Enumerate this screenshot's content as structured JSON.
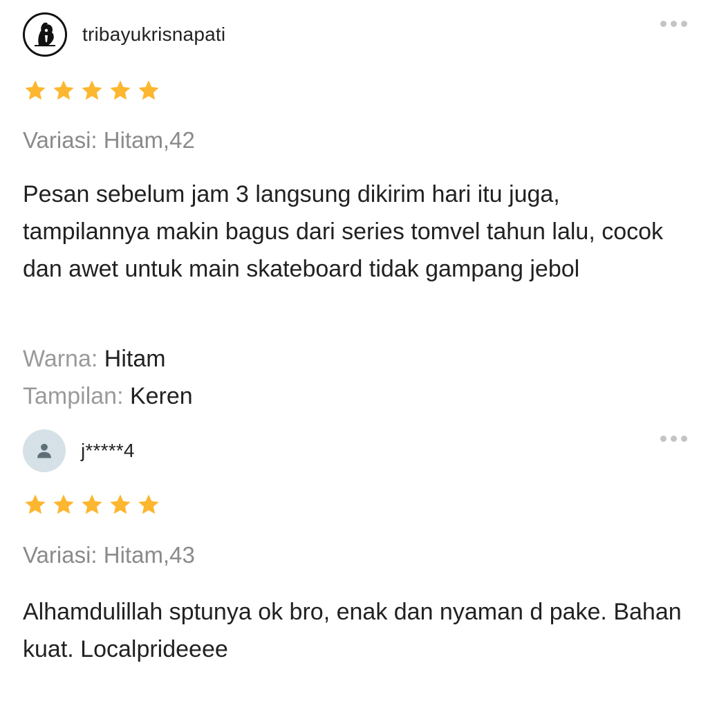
{
  "reviews": [
    {
      "username": "tribayukrisnapati",
      "avatar": "custom-photo-icon",
      "rating": 5,
      "variation": "Variasi: Hitam,42",
      "comment": "Pesan sebelum jam 3 langsung dikirim hari itu juga, tampilannya makin bagus dari series tomvel tahun lalu, cocok dan awet untuk main skateboard tidak gampang jebol",
      "attributes": [
        {
          "label": "Warna:",
          "value": "Hitam"
        },
        {
          "label": "Tampilan:",
          "value": "Keren"
        }
      ]
    },
    {
      "username": "j*****4",
      "avatar": "default-user-icon",
      "rating": 5,
      "variation": "Variasi: Hitam,43",
      "comment": "Alhamdulillah sptunya ok bro, enak dan nyaman d pake. Bahan kuat. Localprideeee"
    }
  ],
  "colors": {
    "star": "#fdb62f",
    "muted_text": "#8a8a8a",
    "body_text": "#212121",
    "default_avatar_bg": "#d5e1e6"
  }
}
